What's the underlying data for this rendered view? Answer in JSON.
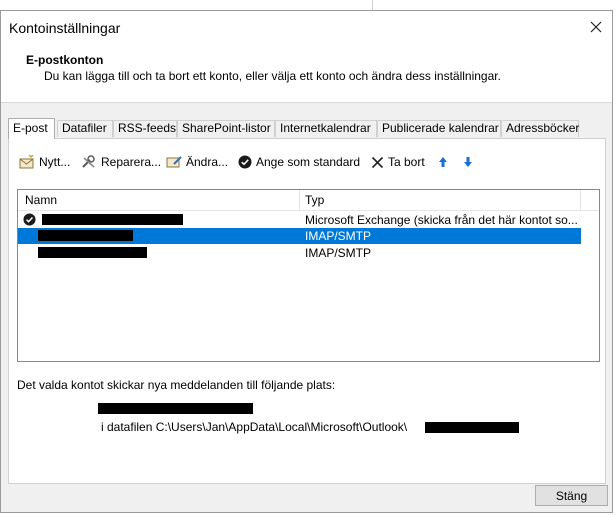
{
  "window": {
    "title": "Kontoinställningar"
  },
  "header": {
    "title": "E-postkonton",
    "description": "Du kan lägga till och ta bort ett konto, eller välja ett konto och ändra dess inställningar."
  },
  "tabs": [
    {
      "label": "E-post",
      "active": true
    },
    {
      "label": "Datafiler"
    },
    {
      "label": "RSS-feeds"
    },
    {
      "label": "SharePoint-listor"
    },
    {
      "label": "Internetkalendrar"
    },
    {
      "label": "Publicerade kalendrar"
    },
    {
      "label": "Adressböcker"
    }
  ],
  "toolbar": {
    "new_label": "Nytt...",
    "repair_label": "Reparera...",
    "change_label": "Ändra...",
    "set_default_label": "Ange som standard",
    "remove_label": "Ta bort",
    "move_up_icon": "arrow-up-icon",
    "move_down_icon": "arrow-down-icon"
  },
  "accounts_table": {
    "columns": [
      "Namn",
      "Typ"
    ],
    "rows": [
      {
        "type": "Microsoft Exchange (skicka från det här kontot so...",
        "default": true,
        "selected": false
      },
      {
        "type": "IMAP/SMTP",
        "default": false,
        "selected": true
      },
      {
        "type": "IMAP/SMTP",
        "default": false,
        "selected": false
      }
    ]
  },
  "delivery": {
    "label": "Det valda kontot skickar nya meddelanden till följande plats:",
    "datafile_text": "i datafilen C:\\Users\\Jan\\AppData\\Local\\Microsoft\\Outlook\\"
  },
  "footer": {
    "close_label": "Stäng"
  },
  "colors": {
    "selection": "#0078d7",
    "arrow_icon": "#1a6fd6"
  }
}
